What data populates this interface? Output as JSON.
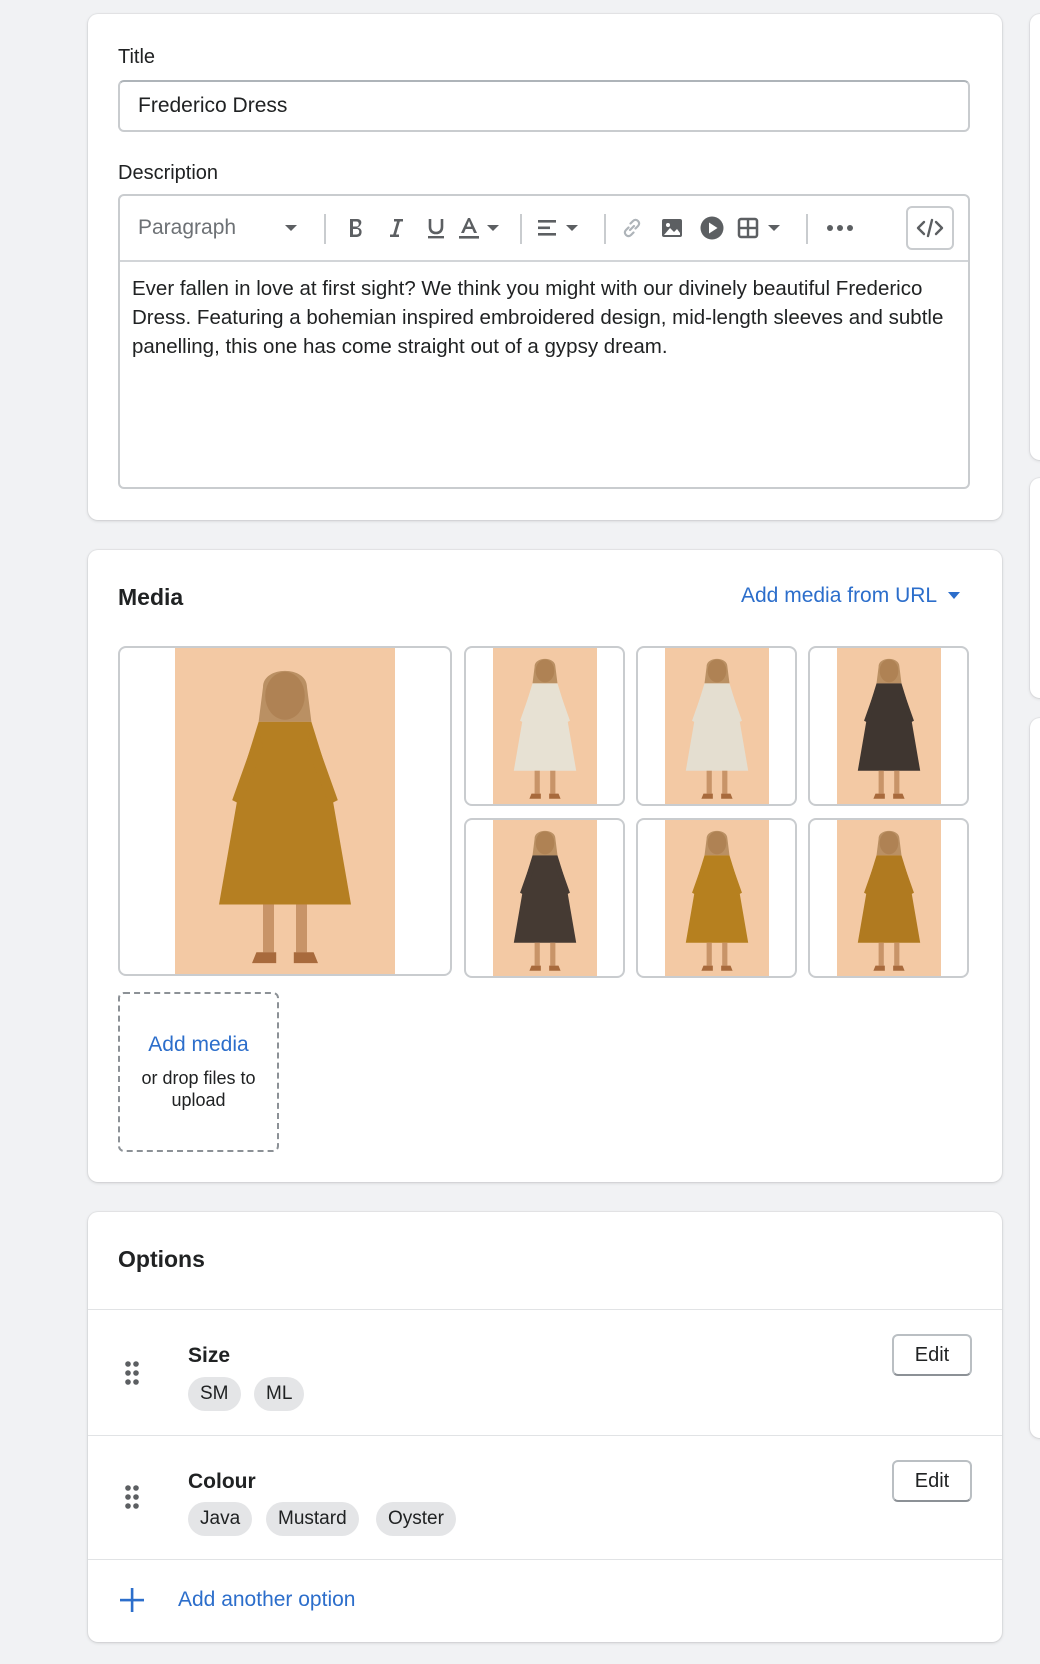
{
  "details": {
    "title_label": "Title",
    "title_value": "Frederico Dress",
    "description_label": "Description",
    "toolbar": {
      "paragraph_label": "Paragraph",
      "icons": [
        "bold-icon",
        "italic-icon",
        "underline-icon",
        "text-color-icon",
        "align-icon",
        "link-icon",
        "image-icon",
        "video-icon",
        "table-icon",
        "more-icon",
        "code-view-icon"
      ]
    },
    "description_text": "Ever fallen in love at first sight? We think you might with our divinely beautiful Frederico Dress. Featuring a bohemian inspired embroidered design, mid-length sleeves and subtle panelling, this one has come straight out of a gypsy dream."
  },
  "media": {
    "title": "Media",
    "add_from_url": "Add media from URL",
    "images": [
      {
        "name": "mustard dress main photo",
        "dress_color": "#b57f22"
      },
      {
        "name": "oyster dress front",
        "dress_color": "#e7e1d3"
      },
      {
        "name": "oyster dress back",
        "dress_color": "#e4ded0"
      },
      {
        "name": "java dress front",
        "dress_color": "#3f3630"
      },
      {
        "name": "java dress back",
        "dress_color": "#453a33"
      },
      {
        "name": "mustard dress close",
        "dress_color": "#b6801f"
      },
      {
        "name": "mustard dress back",
        "dress_color": "#b07a20"
      }
    ],
    "background_color": "#f3c9a4",
    "dropzone_link": "Add media",
    "dropzone_hint": "or drop files to upload"
  },
  "options": {
    "title": "Options",
    "items": [
      {
        "name": "Size",
        "values": [
          "SM",
          "ML"
        ],
        "edit_label": "Edit"
      },
      {
        "name": "Colour",
        "values": [
          "Java",
          "Mustard",
          "Oyster"
        ],
        "edit_label": "Edit"
      }
    ],
    "add_another": "Add another option"
  },
  "colors": {
    "link": "#2c6ecb",
    "border": "#c9cccf",
    "tag_bg": "#e4e5e7"
  }
}
